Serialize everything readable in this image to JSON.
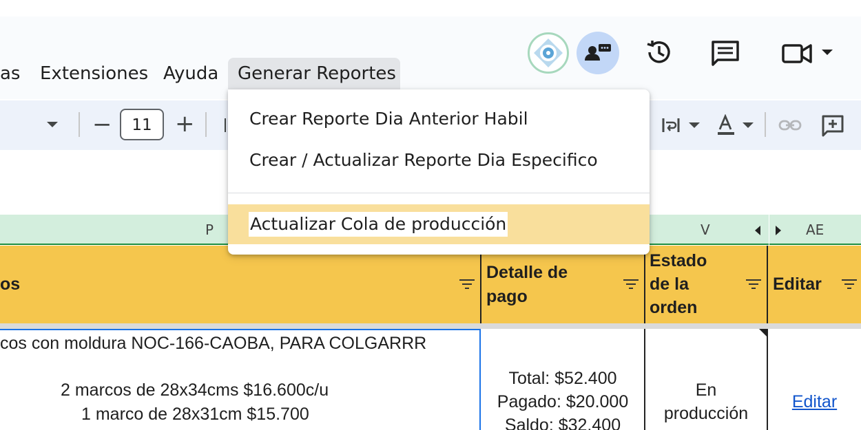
{
  "menubar": {
    "items": [
      "as",
      "Extensiones",
      "Ayuda",
      "Generar Reportes"
    ],
    "active": "Generar Reportes"
  },
  "header_icons": [
    "addon-logo-icon",
    "meet-present-icon",
    "history-icon",
    "comment-icon",
    "video-call-icon",
    "chevron-down-icon"
  ],
  "toolbar": {
    "font_size": "11",
    "minus": "−",
    "plus": "+",
    "icons": [
      "chevron-down-icon",
      "text-wrap-icon",
      "text-color-icon",
      "link-icon",
      "add-comment-icon"
    ]
  },
  "dropdown": {
    "items": [
      "Crear Reporte Dia Anterior Habil",
      "Crear / Actualizar Reporte Dia Especifico",
      "Actualizar Cola de producción"
    ],
    "highlighted_index": 2
  },
  "columns": [
    "P",
    "V",
    "AE"
  ],
  "header_row": {
    "c1": "os",
    "c2_l1": "Detalle de",
    "c2_l2": "pago",
    "c3_l1": "Estado",
    "c3_l2": "de la",
    "c3_l3": "orden",
    "c4": "Editar"
  },
  "data_row": {
    "desc_l1": "cos con moldura NOC-166-CAOBA, PARA COLGARRR",
    "desc_l2": "2 marcos de 28x34cms $16.600c/u",
    "desc_l3": "1 marco de 28x31cm  $15.700",
    "pay_l1": "Total: $52.400",
    "pay_l2": "Pagado: $20.000",
    "pay_l3": "Saldo: $32.400",
    "status_l1": "En",
    "status_l2": "producción",
    "edit_link": "Editar"
  },
  "colors": {
    "header_yellow": "#f5c64d",
    "col_header_green": "#d3eedd",
    "highlight": "#f9df9c",
    "link": "#1155cc"
  }
}
